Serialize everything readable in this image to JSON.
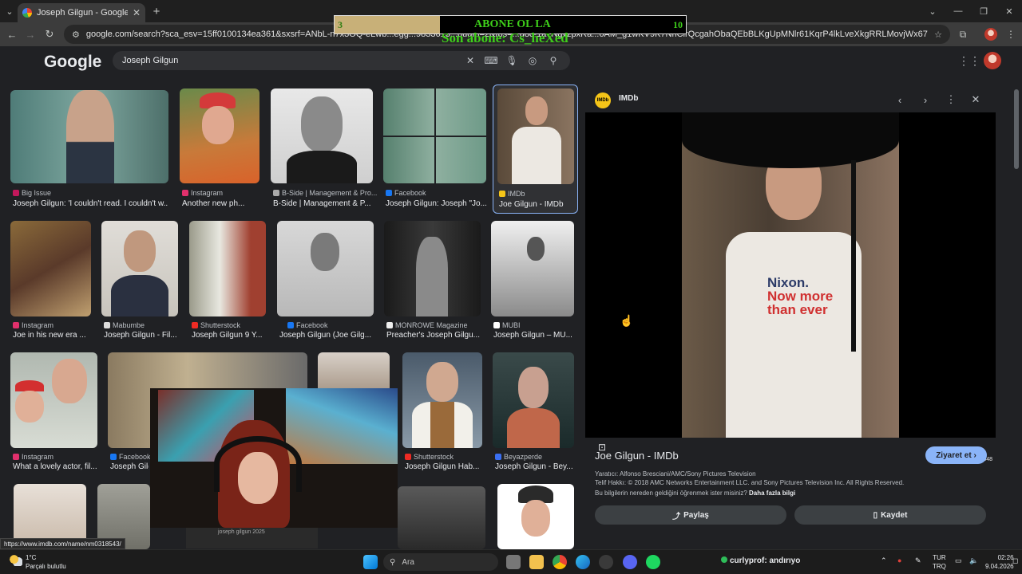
{
  "browser": {
    "tab_title": "Joseph Gilgun - Google'da Ara",
    "tab_close": "✕",
    "new_tab": "+",
    "url": "google.com/search?sca_esv=15ff0100134ea361&sxsrf=ANbL-n7x3OQ-eLwb...egg...9833613...8udm=2&fbs=...d8c-1a7NgvzpxRa...6AM_g1wKV9K7NhClrQcgahObaQEbBLKgUpMNlr61KqrP4lkLveXkgRRLMovjWx67fHkq-IM5Z2ukdE...",
    "status_url": "https://www.imdb.com/name/nm0318543/"
  },
  "overlay": {
    "left_number": "3",
    "title": "ABONE OL LA",
    "right_number": "10",
    "subtitle": "Son abone: Cs_heXed",
    "progress": 0.3
  },
  "google": {
    "logo": "Google",
    "query": "Joseph Gilgun"
  },
  "results": [
    {
      "source": "Big Issue",
      "caption": "Joseph Gilgun: 'I couldn't read. I couldn't w...",
      "fav": "#c2185b"
    },
    {
      "source": "Instagram",
      "caption": "Another new ph...",
      "fav": "#e1306c"
    },
    {
      "source": "B-Side | Management & Pro...",
      "caption": "B-Side | Management & P...",
      "fav": "#aaaaaa"
    },
    {
      "source": "Facebook",
      "caption": "Joseph Gilgun: Joseph \"Jo...",
      "fav": "#1877f2"
    },
    {
      "source": "IMDb",
      "caption": "Joe Gilgun - IMDb",
      "fav": "#f5c518"
    },
    {
      "source": "Instagram",
      "caption": "Joe in his new era ...",
      "fav": "#e1306c"
    },
    {
      "source": "Mabumbe",
      "caption": "Joseph Gilgun - Fil...",
      "fav": "#dddddd"
    },
    {
      "source": "Shutterstock",
      "caption": "Joseph Gilgun 9 Y...",
      "fav": "#ee2b24"
    },
    {
      "source": "Facebook",
      "caption": "Joseph Gilgun (Joe Gilg...",
      "fav": "#1877f2"
    },
    {
      "source": "MONROWE Magazine",
      "caption": "Preacher's Joseph Gilgu...",
      "fav": "#eeeeee"
    },
    {
      "source": "MUBI",
      "caption": "Joseph Gilgun – MU...",
      "fav": "#ffffff"
    },
    {
      "source": "Instagram",
      "caption": "What a lovely actor, fil...",
      "fav": "#e1306c"
    },
    {
      "source": "Facebook",
      "caption": "Joseph Gilg...",
      "fav": "#1877f2"
    },
    {
      "source": "Shutterstock",
      "caption": "Joseph Gilgun Hab...",
      "fav": "#ee2b24"
    },
    {
      "source": "Beyazperde",
      "caption": "Joseph Gilgun - Bey...",
      "fav": "#3a6ff2"
    }
  ],
  "panel": {
    "source": "IMDb",
    "shirt_line1": "Nixon.",
    "shirt_line2": "Now more than ever",
    "dimensions": "1.365 × 2.048",
    "title": "Joe Gilgun - IMDb",
    "visit_label": "Ziyaret et",
    "creator": "Yaratıcı: Alfonso Bresciani/AMC/Sony Pictures Television",
    "copyright": "Telif Hakkı: © 2018 AMC Networks Entertainment LLC. and Sony Pictures Television Inc. All Rights Reserved.",
    "info_question": "Bu bilgilerin nereden geldiğini öğrenmek ister misiniz?",
    "info_link": "Daha fazla bilgi",
    "share_label": "Paylaş",
    "save_label": "Kaydet"
  },
  "stream": {
    "mini_text": "joseph gilgun 2025"
  },
  "taskbar": {
    "temperature": "1°C",
    "weather": "Parçalı bulutlu",
    "search_placeholder": "Ara",
    "chat_user": "curlyprof",
    "chat_message": ": andırıyo",
    "lang1": "TUR",
    "lang2": "TRQ",
    "time": "02:26",
    "date": "9.04.2026"
  }
}
